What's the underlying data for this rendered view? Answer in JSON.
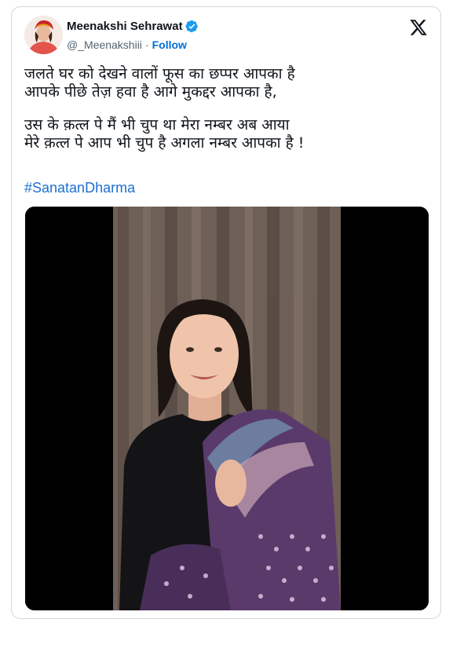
{
  "author": {
    "display_name": "Meenakshi Sehrawat",
    "handle": "@_Meenakshiii",
    "separator": "·",
    "follow_label": "Follow"
  },
  "tweet": {
    "lines": [
      "जलते घर को देखने वालों फूस का छप्पर आपका है",
      "आपके पीछे तेज़ हवा है आगे मुकद्दर आपका है,",
      "उस के क़त्ल पे मैं भी चुप था मेरा नम्बर अब आया",
      "मेरे क़त्ल पे आप भी चुप है अगला नम्बर आपका है !"
    ],
    "hashtag": "#SanatanDharma"
  },
  "colors": {
    "verified": "#1d9bf0",
    "link": "#006fd6",
    "hashtag": "#1d6fd2",
    "border": "#cfd9de",
    "secondary_text": "#536471"
  },
  "icons": {
    "verified": "verified-badge-icon",
    "platform": "x-logo-icon"
  }
}
